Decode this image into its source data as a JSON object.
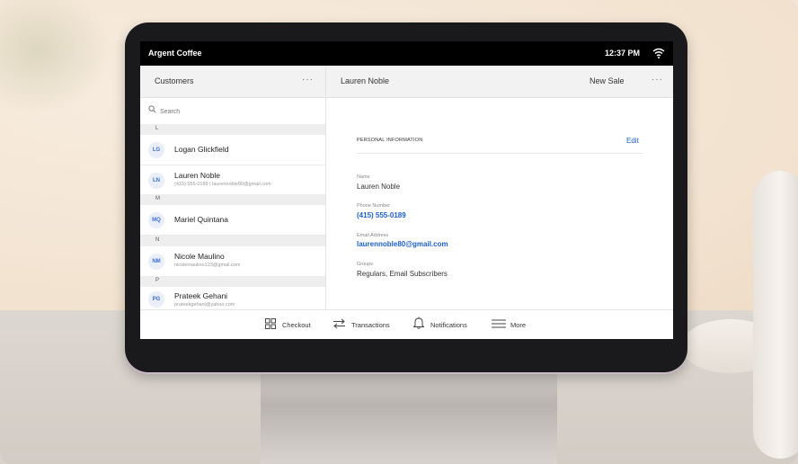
{
  "statusbar": {
    "app_name": "Argent Coffee",
    "time": "12:37 PM",
    "wifi_icon": "wifi-icon"
  },
  "customers": {
    "title": "Customers",
    "more": "···",
    "search_placeholder": "Search",
    "sections": [
      {
        "letter": "L"
      },
      {
        "letter": "M"
      },
      {
        "letter": "N"
      },
      {
        "letter": "P"
      }
    ],
    "rows": [
      {
        "initials": "LG",
        "name": "Logan Glickfield",
        "sub": ""
      },
      {
        "initials": "LN",
        "name": "Lauren Noble",
        "sub": "(415) 555-0189 | laurennoble80@gmail.com"
      },
      {
        "initials": "MQ",
        "name": "Mariel Quintana",
        "sub": ""
      },
      {
        "initials": "NM",
        "name": "Nicole Maulino",
        "sub": "nicolemaulino123@gmail.com"
      },
      {
        "initials": "PG",
        "name": "Prateek Gehani",
        "sub": "prateekgehani@yahoo.com"
      }
    ]
  },
  "detail": {
    "title": "Lauren Noble",
    "new_sale": "New Sale",
    "more": "···",
    "section_heading": "PERSONAL INFORMATION",
    "edit": "Edit",
    "fields": [
      {
        "label": "Name",
        "value": "Lauren Noble"
      },
      {
        "label": "Phone Number",
        "value": "(415) 555-0189"
      },
      {
        "label": "Email Address",
        "value": "laurennoble80@gmail.com"
      },
      {
        "label": "Groups",
        "value": "Regulars, Email Subscribers"
      }
    ]
  },
  "tabbar": {
    "items": [
      {
        "label": "Checkout",
        "icon": "grid-icon"
      },
      {
        "label": "Transactions",
        "icon": "arrows-icon"
      },
      {
        "label": "Notifications",
        "icon": "bell-icon"
      },
      {
        "label": "More",
        "icon": "menu-icon"
      }
    ]
  },
  "colors": {
    "accent": "#1d5fd0",
    "avatar_bg": "#e9eef8"
  }
}
